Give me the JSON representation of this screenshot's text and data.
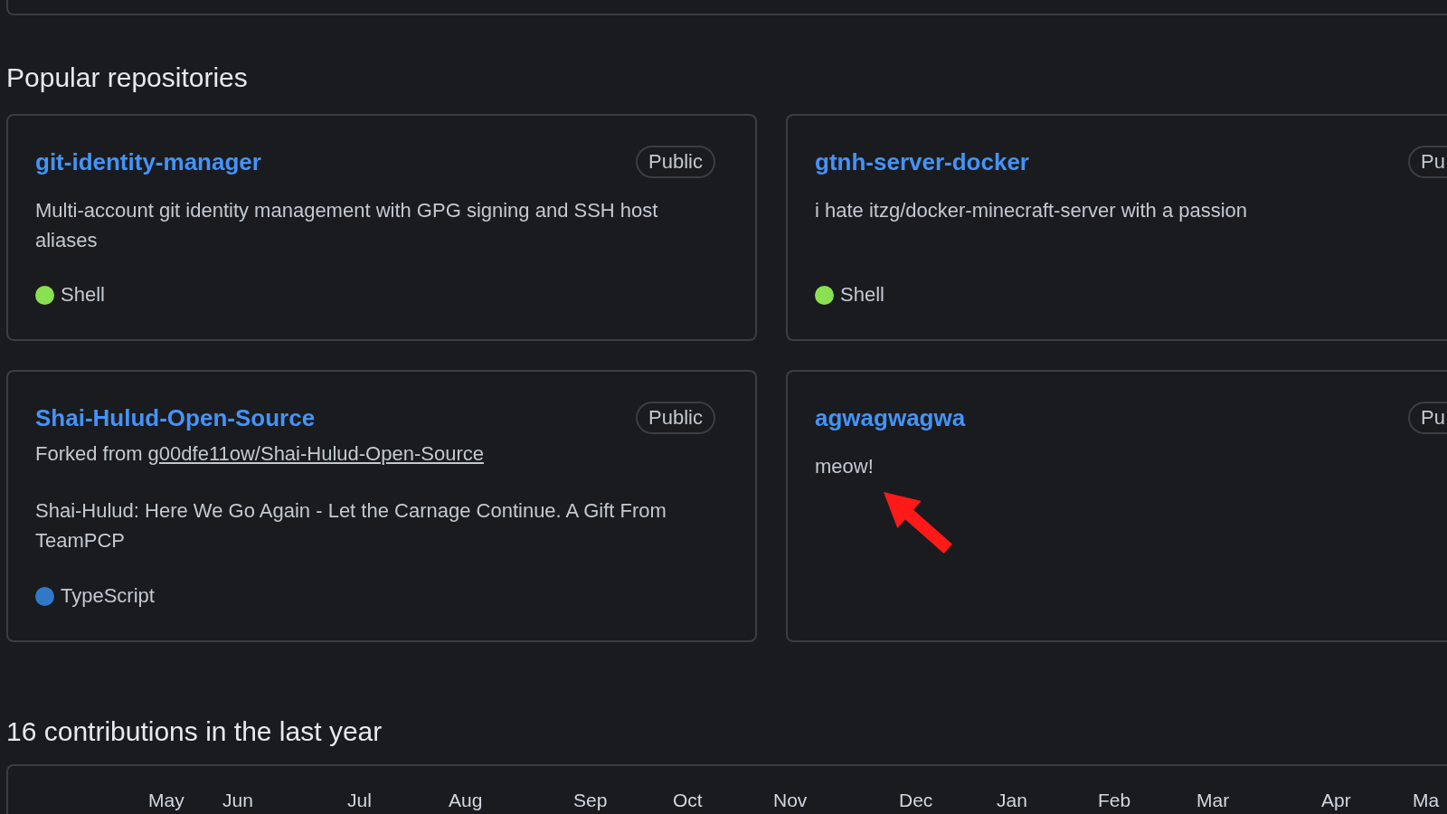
{
  "section_title": "Popular repositories",
  "repositories": [
    {
      "name": "git-identity-manager",
      "visibility": "Public",
      "description": "Multi-account git identity management with GPG signing and SSH host aliases",
      "language": {
        "name": "Shell",
        "color": "#89e051"
      }
    },
    {
      "name": "gtnh-server-docker",
      "visibility": "Pu",
      "description": "i hate itzg/docker-minecraft-server with a passion",
      "language": {
        "name": "Shell",
        "color": "#89e051"
      }
    },
    {
      "name": "Shai-Hulud-Open-Source",
      "visibility": "Public",
      "fork_prefix": "Forked from",
      "fork_source": "g00dfe11ow/Shai-Hulud-Open-Source",
      "description": "Shai-Hulud: Here We Go Again - Let the Carnage Continue. A Gift From TeamPCP",
      "language": {
        "name": "TypeScript",
        "color": "#3178c6"
      }
    },
    {
      "name": "agwagwagwa",
      "visibility": "Pu",
      "description": "meow!"
    }
  ],
  "contributions_title": "16 contributions in the last year",
  "months": [
    "May",
    "Jun",
    "Jul",
    "Aug",
    "Sep",
    "Oct",
    "Nov",
    "Dec",
    "Jan",
    "Feb",
    "Mar",
    "Apr",
    "Ma"
  ]
}
